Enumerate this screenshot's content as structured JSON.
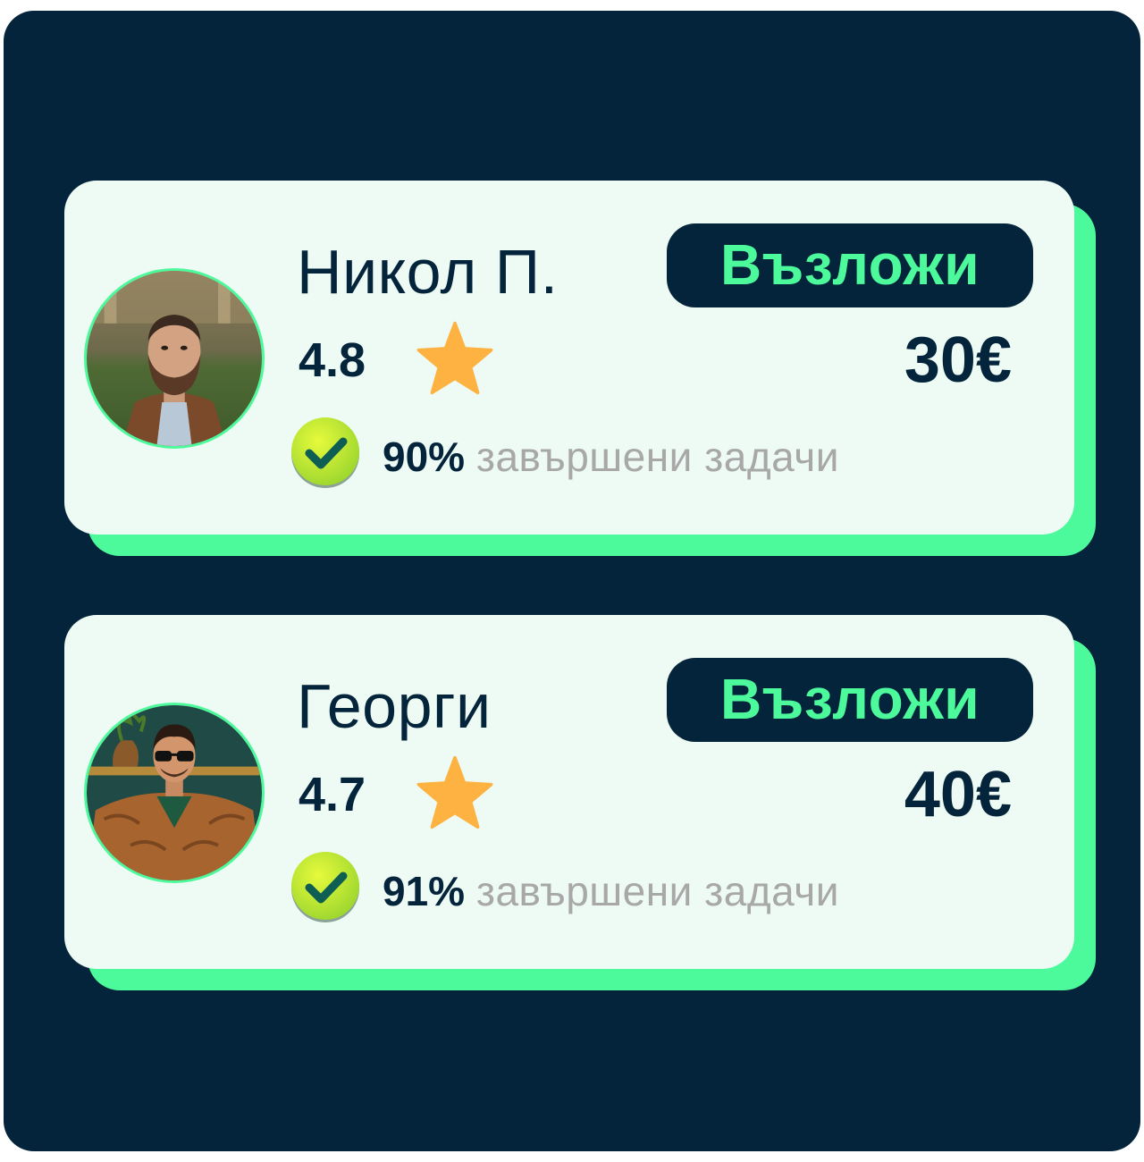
{
  "workers": [
    {
      "name": "Никол П.",
      "rating": "4.8",
      "completion_percent": "90%",
      "completion_text": "завършени задачи",
      "assign_label": "Възложи",
      "price": "30€",
      "avatar": "man-bearded-brown-jacket-photo"
    },
    {
      "name": "Георги",
      "rating": "4.7",
      "completion_percent": "91%",
      "completion_text": "завършени задачи",
      "assign_label": "Възложи",
      "price": "40€",
      "avatar": "man-sunglasses-fur-coat-photo"
    }
  ],
  "icons": {
    "rating": "star-icon",
    "completion": "checkmark-icon"
  },
  "colors": {
    "background": "#03243A",
    "card": "#EDFBF4",
    "accent": "#4CFA9B",
    "text_dark": "#03243A",
    "text_muted": "#A8A8A8",
    "star": "#FDB241",
    "check_badge": "#C7F03A"
  }
}
